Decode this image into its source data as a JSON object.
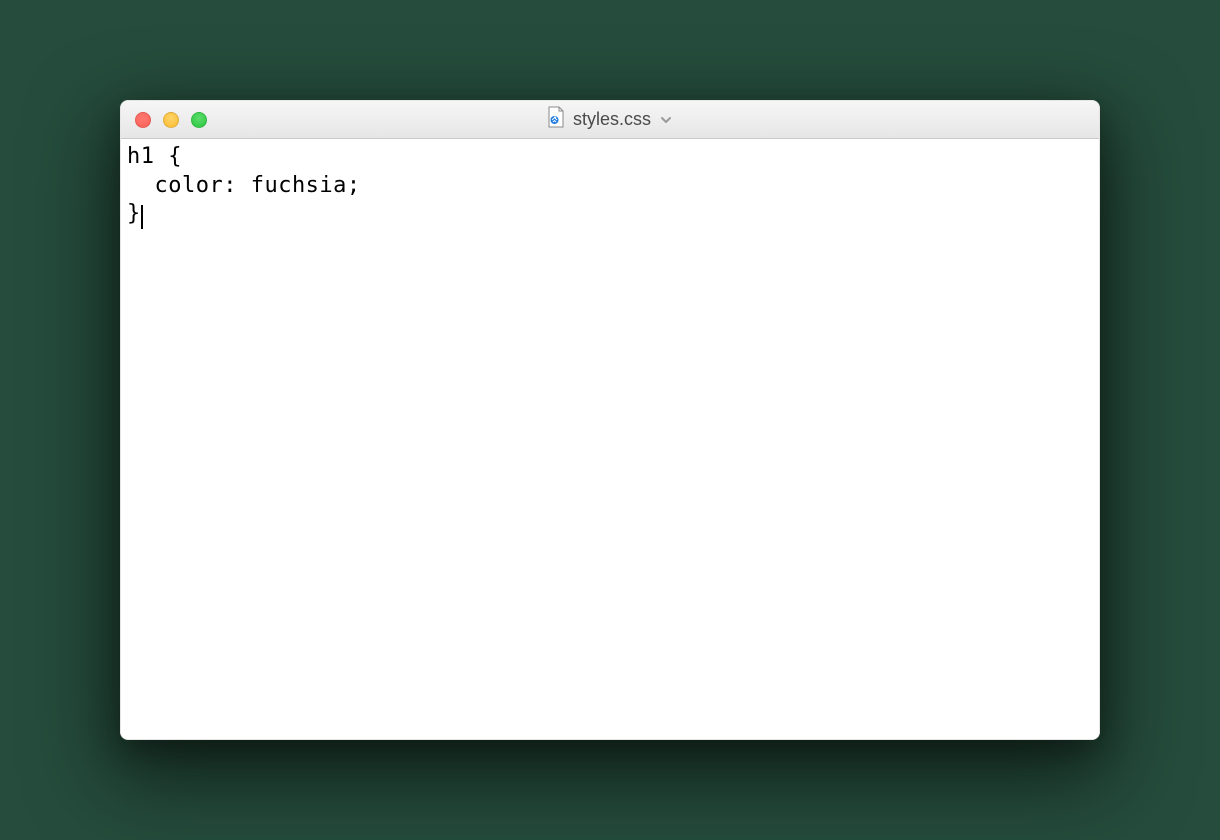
{
  "window": {
    "title": "styles.css"
  },
  "icons": {
    "file": "file-icon",
    "chevron": "chevron-down-icon"
  },
  "editor": {
    "content": "h1 {\n  color: fuchsia;\n}",
    "cursor_line": 3,
    "cursor_col": 2
  }
}
